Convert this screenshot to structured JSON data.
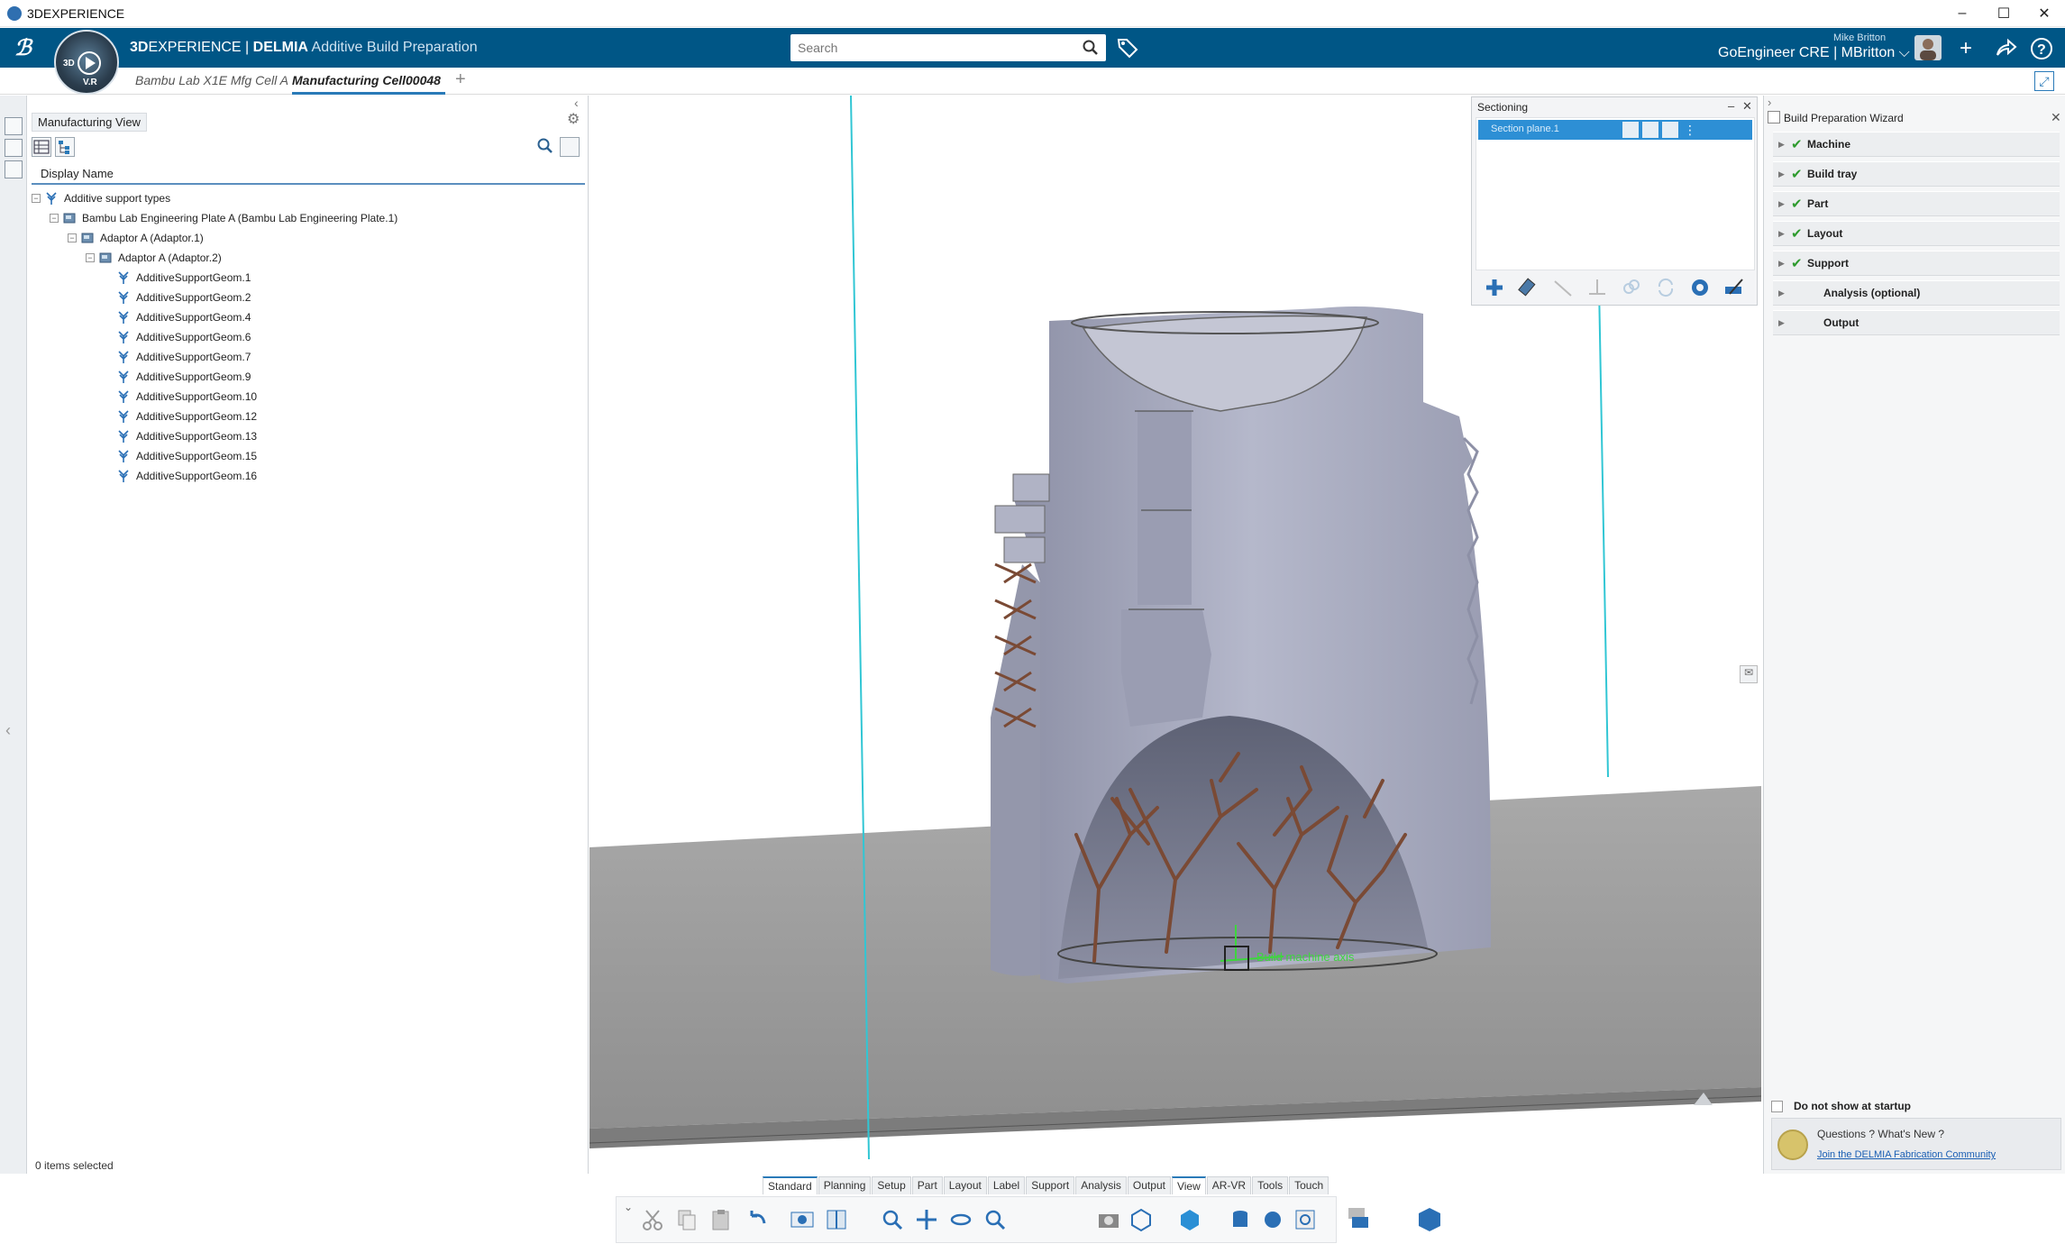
{
  "window": {
    "title": "3DEXPERIENCE",
    "minimize": "–",
    "maximize": "☐",
    "close": "✕"
  },
  "header": {
    "brand_3d": "3D",
    "brand_experience": "EXPERIENCE",
    "brand_sep": " | ",
    "brand_delmia": "DELMIA",
    "brand_app": "Additive Build Preparation",
    "compass_3d": "3D",
    "compass_vr": "V.R",
    "search_placeholder": "Search",
    "user_name": "Mike Britton",
    "user_context": "GoEngineer CRE | MBritton ⌵",
    "icons": [
      "ds-logo-icon",
      "search-icon",
      "tag-icon",
      "plus-icon",
      "share-icon",
      "help-icon"
    ]
  },
  "tabs": [
    {
      "label": "Bambu Lab X1E Mfg Cell A",
      "active": false
    },
    {
      "label": "Manufacturing Cell00048",
      "active": true
    }
  ],
  "tab_add": "+",
  "tree_panel": {
    "title": "Manufacturing View",
    "column_header": "Display Name",
    "status": "0 items selected",
    "rows": [
      {
        "label": "Additive support types",
        "level": 0,
        "toggle": "−"
      },
      {
        "label": "Bambu Lab Engineering Plate A (Bambu Lab Engineering Plate.1)",
        "level": 1,
        "toggle": "−"
      },
      {
        "label": "Adaptor A (Adaptor.1)",
        "level": 2,
        "toggle": "−"
      },
      {
        "label": "Adaptor A (Adaptor.2)",
        "level": 3,
        "toggle": "−"
      },
      {
        "label": "AdditiveSupportGeom.1",
        "level": 4,
        "toggle": ""
      },
      {
        "label": "AdditiveSupportGeom.2",
        "level": 4,
        "toggle": ""
      },
      {
        "label": "AdditiveSupportGeom.4",
        "level": 4,
        "toggle": ""
      },
      {
        "label": "AdditiveSupportGeom.6",
        "level": 4,
        "toggle": ""
      },
      {
        "label": "AdditiveSupportGeom.7",
        "level": 4,
        "toggle": ""
      },
      {
        "label": "AdditiveSupportGeom.9",
        "level": 4,
        "toggle": ""
      },
      {
        "label": "AdditiveSupportGeom.10",
        "level": 4,
        "toggle": ""
      },
      {
        "label": "AdditiveSupportGeom.12",
        "level": 4,
        "toggle": ""
      },
      {
        "label": "AdditiveSupportGeom.13",
        "level": 4,
        "toggle": ""
      },
      {
        "label": "AdditiveSupportGeom.15",
        "level": 4,
        "toggle": ""
      },
      {
        "label": "AdditiveSupportGeom.16",
        "level": 4,
        "toggle": ""
      }
    ]
  },
  "sectioning": {
    "title": "Sectioning",
    "plane_label": "Section plane.1"
  },
  "viewport": {
    "axis_label": "Build machine axis"
  },
  "wizard": {
    "title": "Build Preparation Wizard",
    "steps": [
      {
        "label": "Machine",
        "done": true
      },
      {
        "label": "Build tray",
        "done": true
      },
      {
        "label": "Part",
        "done": true
      },
      {
        "label": "Layout",
        "done": true
      },
      {
        "label": "Support",
        "done": true
      },
      {
        "label": "Analysis (optional)",
        "done": false
      },
      {
        "label": "Output",
        "done": false
      }
    ],
    "startup_label": "Do not show at startup",
    "questions": "Questions ? What's New ?",
    "community_link": "Join the DELMIA Fabrication Community"
  },
  "bottom_tabs": [
    {
      "label": "Standard",
      "active": true
    },
    {
      "label": "Planning",
      "active": false
    },
    {
      "label": "Setup",
      "active": false
    },
    {
      "label": "Part",
      "active": false
    },
    {
      "label": "Layout",
      "active": false
    },
    {
      "label": "Label",
      "active": false
    },
    {
      "label": "Support",
      "active": false
    },
    {
      "label": "Analysis",
      "active": false
    },
    {
      "label": "Output",
      "active": false
    },
    {
      "label": "View",
      "active": true
    },
    {
      "label": "AR-VR",
      "active": false
    },
    {
      "label": "Tools",
      "active": false
    },
    {
      "label": "Touch",
      "active": false
    }
  ],
  "colors": {
    "header_bg": "#005686",
    "accent": "#2a7ab8",
    "selection": "#2d8fd5",
    "check": "#2e9b2e",
    "support": "#7a4a35",
    "part": "#a7aabd",
    "axis": "#3ed63e"
  }
}
